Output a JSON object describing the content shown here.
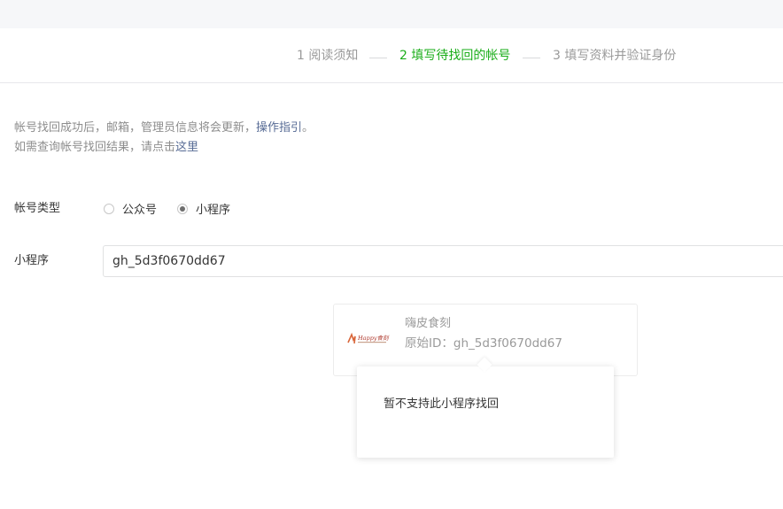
{
  "steps": [
    {
      "label": "1 阅读须知",
      "state": "done"
    },
    {
      "label": "2 填写待找回的帐号",
      "state": "active"
    },
    {
      "label": "3 填写资料并验证身份",
      "state": "pending"
    }
  ],
  "notice": {
    "line1_text": "帐号找回成功后，邮箱，管理员信息将会更新，",
    "line1_link": "操作指引",
    "line1_end": "。",
    "line2_text": "如需查询帐号找回结果，请点击",
    "line2_link": "这里"
  },
  "account_type": {
    "label": "帐号类型",
    "options": [
      {
        "label": "公众号",
        "checked": false
      },
      {
        "label": "小程序",
        "checked": true
      }
    ]
  },
  "miniprogram": {
    "label": "小程序",
    "value": "gh_5d3f0670dd67"
  },
  "result_card": {
    "name": "嗨皮食刻",
    "original_id": "原始ID：gh_5d3f0670dd67",
    "logo_text": "Happy食刻"
  },
  "popover": {
    "message": "暂不支持此小程序找回"
  },
  "colors": {
    "accent": "#1aad19",
    "link": "#576b95"
  }
}
